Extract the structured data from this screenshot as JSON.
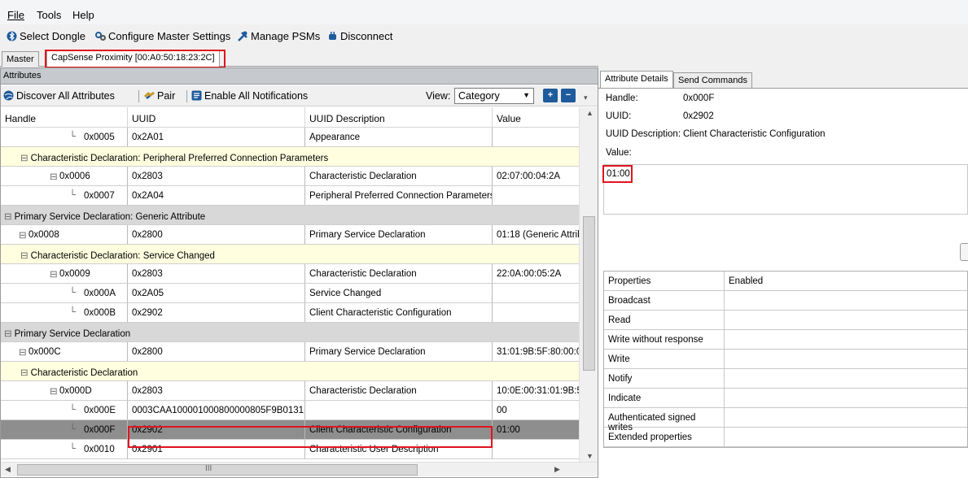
{
  "menu": [
    "File",
    "Tools",
    "Help"
  ],
  "toolbar": {
    "select_dongle": "Select Dongle",
    "configure_master": "Configure Master Settings",
    "manage_psms": "Manage PSMs",
    "disconnect": "Disconnect"
  },
  "tabs": [
    "Master",
    "CapSense Proximity [00:A0:50:18:23:2C]"
  ],
  "attributes_panel": {
    "caption": "Attributes",
    "discover_all": "Discover All Attributes",
    "pair": "Pair",
    "enable_notifications": "Enable All Notifications",
    "view_label": "View:",
    "view_value": "Category"
  },
  "grid": {
    "columns": [
      "Handle",
      "UUID",
      "UUID Description",
      "Value"
    ],
    "rows": [
      {
        "type": "attr",
        "handle": "0x0005",
        "uuid": "0x2A01",
        "desc": "Appearance",
        "value": "",
        "indent": 3
      },
      {
        "type": "charsec",
        "label": "Characteristic Declaration: Peripheral Preferred Connection Parameters",
        "indent": 1
      },
      {
        "type": "attr",
        "handle": "0x0006",
        "uuid": "0x2803",
        "desc": "Characteristic Declaration",
        "value": "02:07:00:04:2A",
        "indent": 2,
        "expander": true
      },
      {
        "type": "attr",
        "handle": "0x0007",
        "uuid": "0x2A04",
        "desc": "Peripheral Preferred Connection Parameters",
        "value": "",
        "indent": 3
      },
      {
        "type": "section",
        "label": "Primary Service Declaration: Generic Attribute",
        "indent": 0
      },
      {
        "type": "attr",
        "handle": "0x0008",
        "uuid": "0x2800",
        "desc": "Primary Service Declaration",
        "value": "01:18 (Generic Attrib",
        "indent": 1,
        "expander": true
      },
      {
        "type": "charsec",
        "label": "Characteristic Declaration: Service Changed",
        "indent": 1
      },
      {
        "type": "attr",
        "handle": "0x0009",
        "uuid": "0x2803",
        "desc": "Characteristic Declaration",
        "value": "22:0A:00:05:2A",
        "indent": 2,
        "expander": true
      },
      {
        "type": "attr",
        "handle": "0x000A",
        "uuid": "0x2A05",
        "desc": "Service Changed",
        "value": "",
        "indent": 3
      },
      {
        "type": "attr",
        "handle": "0x000B",
        "uuid": "0x2902",
        "desc": "Client Characteristic Configuration",
        "value": "",
        "indent": 3
      },
      {
        "type": "section",
        "label": "Primary Service Declaration",
        "indent": 0
      },
      {
        "type": "attr",
        "handle": "0x000C",
        "uuid": "0x2800",
        "desc": "Primary Service Declaration",
        "value": "31:01:9B:5F:80:00:0",
        "indent": 1,
        "expander": true
      },
      {
        "type": "charsec",
        "label": "Characteristic Declaration",
        "indent": 1
      },
      {
        "type": "attr",
        "handle": "0x000D",
        "uuid": "0x2803",
        "desc": "Characteristic Declaration",
        "value": "10:0E:00:31:01:9B:5",
        "indent": 2,
        "expander": true
      },
      {
        "type": "attr",
        "handle": "0x000E",
        "uuid": "0003CAA100001000800000805F9B0131",
        "desc": "",
        "value": "00",
        "indent": 3
      },
      {
        "type": "attr",
        "handle": "0x000F",
        "uuid": "0x2902",
        "desc": "Client Characteristic Configuration",
        "value": "01:00",
        "indent": 3,
        "selected": true
      },
      {
        "type": "attr",
        "handle": "0x0010",
        "uuid": "0x2901",
        "desc": "Characteristic User Description",
        "value": "",
        "indent": 3
      }
    ]
  },
  "right_tabs": [
    "Attribute Details",
    "Send Commands"
  ],
  "details": {
    "handle_label": "Handle:",
    "handle_value": "0x000F",
    "uuid_label": "UUID:",
    "uuid_value": "0x2902",
    "uuid_desc_label": "UUID Description:",
    "uuid_desc_value": "Client Characteristic Configuration",
    "value_label": "Value:",
    "value": "01:00"
  },
  "properties": {
    "header": [
      "Properties",
      "Enabled"
    ],
    "rows": [
      "Broadcast",
      "Read",
      "Write without response",
      "Write",
      "Notify",
      "Indicate",
      "Authenticated signed writes",
      "Extended properties"
    ]
  },
  "hscroll_mark": "III",
  "colors": {
    "highlight": "#e0141e",
    "section_bg": "#d8d8d8",
    "char_bg": "#ffffe0",
    "selected_bg": "#8e8e8e"
  }
}
